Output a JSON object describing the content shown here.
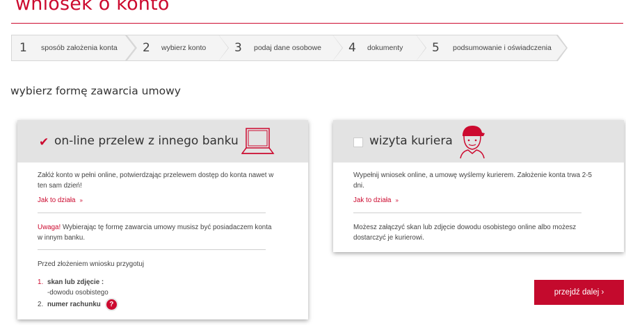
{
  "page": {
    "title": "wniosek o konto"
  },
  "steps": [
    {
      "num": "1",
      "label": "sposób założenia konta"
    },
    {
      "num": "2",
      "label": "wybierz konto"
    },
    {
      "num": "3",
      "label": "podaj dane osobowe"
    },
    {
      "num": "4",
      "label": "dokumenty"
    },
    {
      "num": "5",
      "label": "podsumowanie i oświadczenia"
    }
  ],
  "subtitle": "wybierz formę zawarcia umowy",
  "options": {
    "online": {
      "title": "on-line przelew z innego banku",
      "checked": true,
      "icon": "laptop-icon",
      "description": "Załóż konto w pełni online, potwierdzając przelewem dostęp do konta nawet w ten sam dzień!",
      "howto": "Jak to działa",
      "warning_label": "Uwaga!",
      "warning_text": " Wybierając tę formę zawarcia umowy musisz być posiadaczem konta w innym banku.",
      "prepare_heading": "Przed złożeniem wniosku przygotuj",
      "items": [
        {
          "num": "1.",
          "bold": "skan lub zdjęcie :",
          "sub": "-dowodu osobistego"
        },
        {
          "num": "2.",
          "bold": "numer rachunku",
          "help": "?"
        }
      ]
    },
    "courier": {
      "title": "wizyta kuriera",
      "checked": false,
      "icon": "courier-icon",
      "description": "Wypełnij wniosek online, a umowę wyślemy kurierem. Założenie konta trwa 2-5 dni.",
      "howto": "Jak to działa",
      "note": "Możesz załączyć skan lub zdjęcie dowodu osobistego online albo możesz dostarczyć je kurierowi."
    }
  },
  "next_button": "przejdź dalej ›",
  "colors": {
    "accent": "#cc0a2f",
    "card_header": "#e3e3e3",
    "step_bg": "#f4f4f4"
  }
}
